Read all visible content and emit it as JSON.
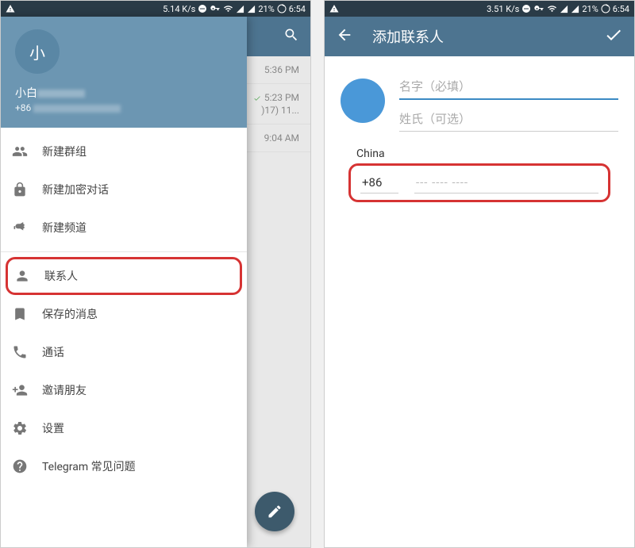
{
  "status": {
    "speed1": "5.14 K/s",
    "speed2": "3.51 K/s",
    "battery": "21%",
    "time": "6:54"
  },
  "phone1": {
    "drawer": {
      "avatar_initial": "小",
      "username_prefix": "小白",
      "phone_prefix": "+86",
      "menu": {
        "new_group": "新建群组",
        "secret_chat": "新建加密对话",
        "new_channel": "新建频道",
        "contacts": "联系人",
        "saved_messages": "保存的消息",
        "calls": "通话",
        "invite": "邀请朋友",
        "settings": "设置",
        "faq": "Telegram 常见问题"
      }
    },
    "chats": {
      "c1_time": "5:36 PM",
      "c2_time": "5:23 PM",
      "c2_snippet": ")17) 11...",
      "c3_time": "9:04 AM"
    }
  },
  "phone2": {
    "title": "添加联系人",
    "first_name_placeholder": "名字（必填）",
    "last_name_placeholder": "姓氏（可选）",
    "country": "China",
    "country_code": "+86",
    "phone_placeholder": "--- ---- ----"
  }
}
